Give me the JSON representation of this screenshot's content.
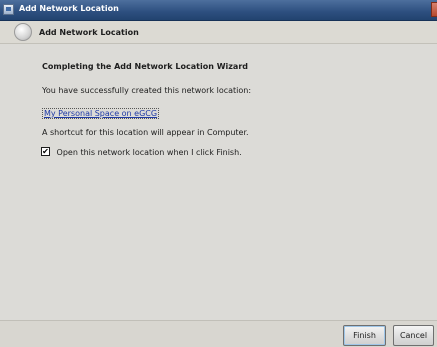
{
  "window": {
    "title": "Add Network Location"
  },
  "header": {
    "title": "Add Network Location"
  },
  "content": {
    "heading": "Completing the Add Network Location Wizard",
    "success_text": "You have successfully created this network location:",
    "location_link": "My Personal Space on eGCG",
    "shortcut_text": "A shortcut for this location will appear in Computer.",
    "open_checkbox": {
      "label": "Open this network location when I click Finish.",
      "checked": true,
      "mark": "✔"
    }
  },
  "footer": {
    "finish_label": "Finish",
    "cancel_label": "Cancel"
  },
  "colors": {
    "titlebar": "#2d4f7f",
    "link": "#1f3aa6",
    "content_background": "#dcdbd7"
  }
}
